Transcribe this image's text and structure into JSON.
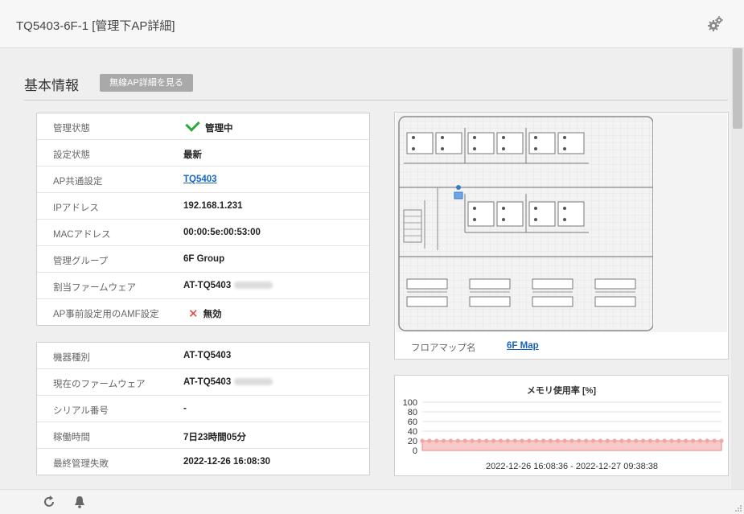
{
  "window": {
    "title": "TQ5403-6F-1 [管理下AP詳細]"
  },
  "section": {
    "title": "基本情報",
    "button_label": "無線AP詳細を見る"
  },
  "info_card": [
    {
      "label": "管理状態",
      "value": "管理中",
      "icon": "check-icon"
    },
    {
      "label": "設定状態",
      "value": "最新"
    },
    {
      "label": "AP共通設定",
      "value": "TQ5403",
      "link": true
    },
    {
      "label": "IPアドレス",
      "value": "192.168.1.231"
    },
    {
      "label": "MACアドレス",
      "value": "00:00:5e:00:53:00"
    },
    {
      "label": "管理グループ",
      "value": "6F Group"
    },
    {
      "label": "割当ファームウェア",
      "value": "AT-TQ5403",
      "blurred_suffix": true
    },
    {
      "label": "AP事前設定用のAMF設定",
      "value": "無効",
      "icon": "x-icon"
    }
  ],
  "device_card": [
    {
      "label": "機器種別",
      "value": "AT-TQ5403"
    },
    {
      "label": "現在のファームウェア",
      "value": "AT-TQ5403",
      "blurred_suffix": true
    },
    {
      "label": "シリアル番号",
      "value": "-"
    },
    {
      "label": "稼働時間",
      "value": "7日23時間05分"
    },
    {
      "label": "最終管理失敗",
      "value": "2022-12-26 16:08:30"
    }
  ],
  "floormap": {
    "label": "フロアマップ名",
    "value": "6F Map"
  },
  "chart_data": {
    "type": "area",
    "title": "メモリ使用率 [%]",
    "ylim": [
      0,
      100
    ],
    "yticks": [
      "100",
      "80",
      "60",
      "40",
      "20",
      "0"
    ],
    "x_range_label": "2022-12-26 16:08:36 - 2022-12-27 09:38:38",
    "values": [
      20,
      20,
      20,
      20,
      20,
      20,
      20,
      20,
      20,
      20,
      20,
      20,
      20,
      20,
      20,
      20,
      20,
      20,
      20,
      20,
      20,
      20,
      20,
      20,
      20,
      20,
      20,
      20,
      20,
      20,
      20,
      20,
      20,
      20,
      20,
      20,
      20,
      20,
      20,
      20,
      20,
      20,
      20
    ],
    "colors": {
      "line": "#e88a8a",
      "fill": "#f8c9c9",
      "marker": "#f2a5a5"
    }
  },
  "colors": {
    "accent_link": "#1565c0",
    "check": "#2eaa3b",
    "x": "#e0412f",
    "button": "#a9a9a9"
  }
}
